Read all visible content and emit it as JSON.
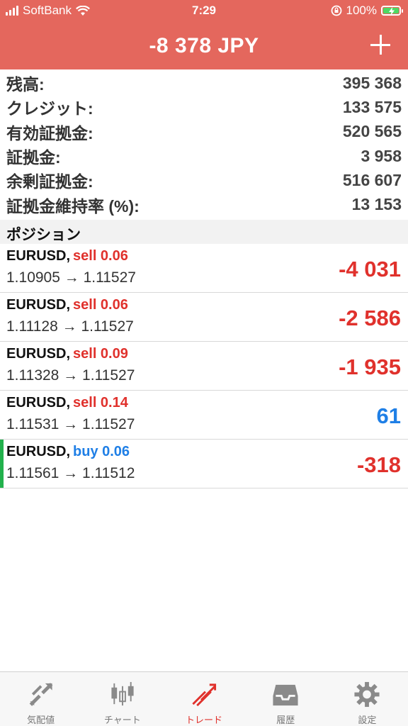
{
  "status_bar": {
    "carrier": "SoftBank",
    "time": "7:29",
    "battery": "100%"
  },
  "header": {
    "title": "-8 378 JPY"
  },
  "summary": [
    {
      "label": "残高:",
      "value": "395 368"
    },
    {
      "label": "クレジット:",
      "value": "133 575"
    },
    {
      "label": "有効証拠金:",
      "value": "520 565"
    },
    {
      "label": "証拠金:",
      "value": "3 958"
    },
    {
      "label": "余剰証拠金:",
      "value": "516 607"
    },
    {
      "label": "証拠金維持率 (%):",
      "value": "13 153"
    }
  ],
  "positions_header": "ポジション",
  "positions": [
    {
      "symbol": "EURUSD,",
      "side": "sell 0.06",
      "prices": "1.10905 → 1.11527",
      "profit": "-4 031"
    },
    {
      "symbol": "EURUSD,",
      "side": "sell 0.06",
      "prices": "1.11128 → 1.11527",
      "profit": "-2 586"
    },
    {
      "symbol": "EURUSD,",
      "side": "sell 0.09",
      "prices": "1.11328 → 1.11527",
      "profit": "-1 935"
    },
    {
      "symbol": "EURUSD,",
      "side": "sell 0.14",
      "prices": "1.11531 → 1.11527",
      "profit": "61"
    },
    {
      "symbol": "EURUSD,",
      "side": "buy 0.06",
      "prices": "1.11561 → 1.11512",
      "profit": "-318"
    }
  ],
  "tabs": [
    {
      "label": "気配値",
      "icon": "quotes-icon"
    },
    {
      "label": "チャート",
      "icon": "chart-icon"
    },
    {
      "label": "トレード",
      "icon": "trade-icon"
    },
    {
      "label": "履歴",
      "icon": "history-icon"
    },
    {
      "label": "設定",
      "icon": "settings-icon"
    }
  ],
  "colors": {
    "header_bg": "#e4675d",
    "loss": "#e0312c",
    "gain": "#1f7fe6",
    "selected_marker": "#22b14c",
    "battery_fill": "#4cd964"
  }
}
